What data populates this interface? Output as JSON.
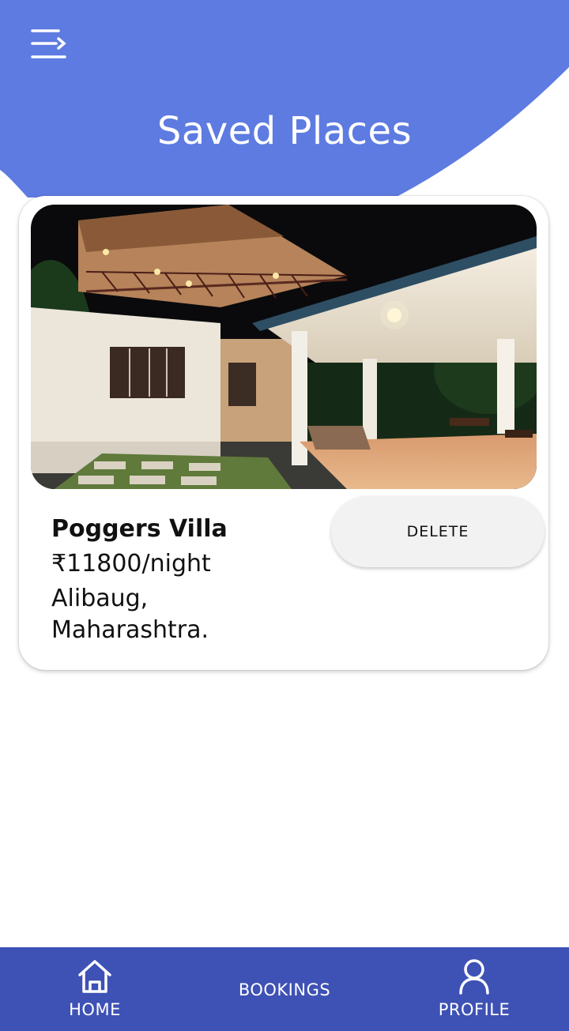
{
  "header": {
    "title": "Saved Places",
    "menu_icon": "menu-icon",
    "bg_color": "#5e7be1"
  },
  "saved_places": [
    {
      "name": "Poggers Villa",
      "price": "₹11800/night",
      "location": "Alibaug, Maharashtra.",
      "delete_label": "DELETE",
      "photo_icon": "villa-photo"
    }
  ],
  "bottom_nav": {
    "bg_color": "#3e51b5",
    "items": [
      {
        "label": "HOME",
        "icon": "home-icon"
      },
      {
        "label": "BOOKINGS",
        "icon": ""
      },
      {
        "label": "PROFILE",
        "icon": "user-icon"
      }
    ]
  }
}
